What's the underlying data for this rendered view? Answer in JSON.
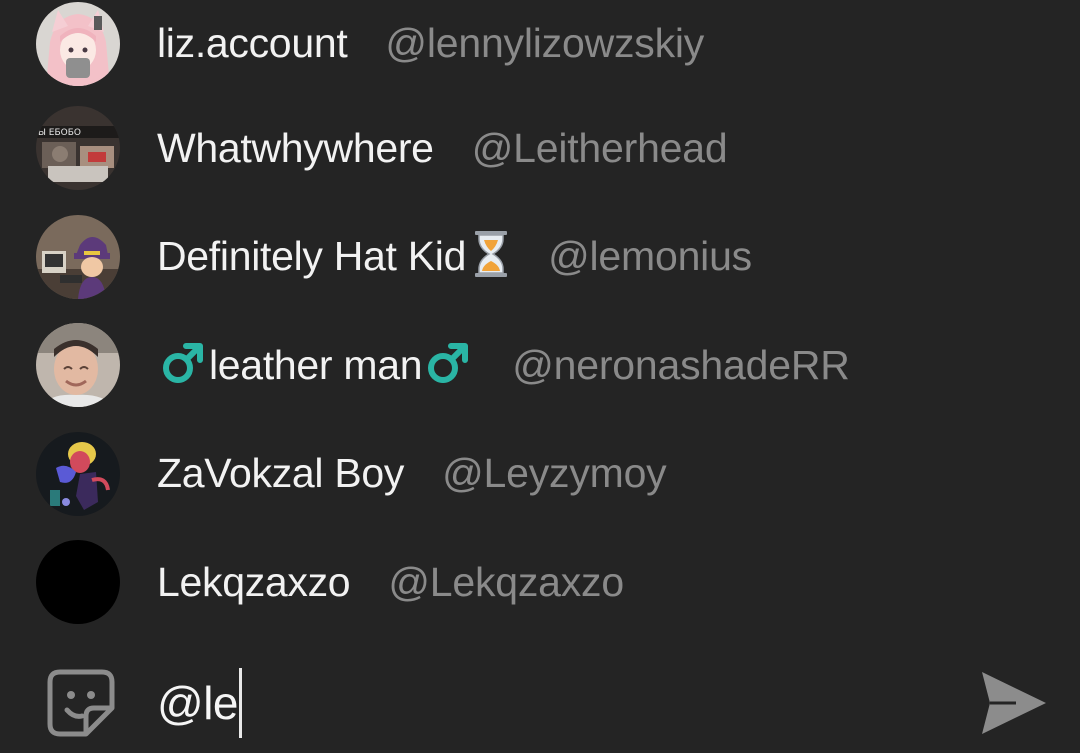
{
  "mentions": [
    {
      "display_name": "liz.account",
      "username": "@lennylizowzskiy",
      "avatar": "anime-girl-avatar"
    },
    {
      "display_name": "Whatwhywhere",
      "username": "@Leitherhead",
      "avatar": "meme-photo-avatar",
      "avatar_caption": "Ы ЕБОБО"
    },
    {
      "display_name": "Definitely Hat Kid",
      "username": "@lemonius",
      "avatar": "hat-kid-avatar",
      "suffix_icon": "hourglass-icon"
    },
    {
      "display_name": "leather man",
      "username": "@neronashadeRR",
      "avatar": "man-photo-avatar",
      "prefix_icon": "male-sign-icon",
      "suffix_icon": "male-sign-icon"
    },
    {
      "display_name": "ZaVokzal Boy",
      "username": "@Leyzymoy",
      "avatar": "dark-art-avatar"
    },
    {
      "display_name": "Lekqzaxzo",
      "username": "@Lekqzaxzo",
      "avatar": "black-avatar"
    }
  ],
  "composer": {
    "text": "@le",
    "sticker_icon": "sticker-icon",
    "send_icon": "send-icon"
  },
  "colors": {
    "background": "#242424",
    "display_name": "#f2f2f2",
    "username": "#8a8a8a",
    "male_sign": "#2ab5a5",
    "icon_gray": "#8c8c8c"
  }
}
